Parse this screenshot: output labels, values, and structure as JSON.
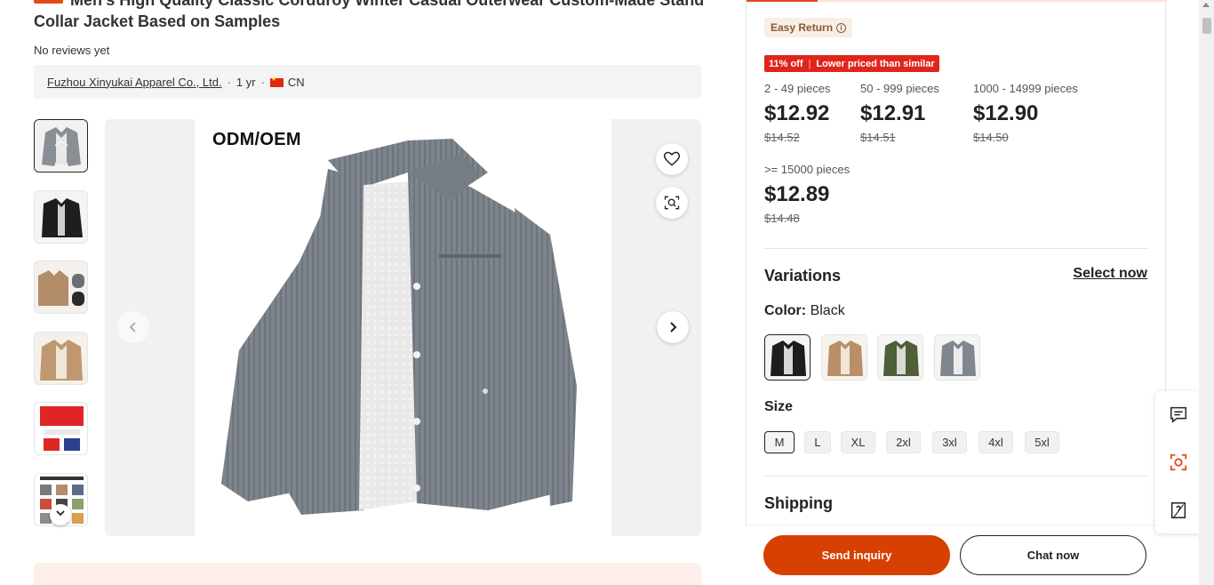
{
  "product": {
    "title": "Men's High Quality Classic Corduroy Winter Casual Outerwear Custom-Made Stand Collar Jacket Based on Samples",
    "reviews": "No reviews yet"
  },
  "supplier": {
    "name": "Fuzhou Xinyukai Apparel Co., Ltd.",
    "years": "1 yr",
    "country": "CN"
  },
  "gallery": {
    "main_label": "ODM/OEM",
    "thumbnails": [
      "gray-jacket-thumbnail",
      "black-jacket-thumbnail",
      "khaki-jacket-set-thumbnail",
      "khaki-jacket-thumbnail",
      "custom-brand-thumbnail",
      "custom-solutions-thumbnail"
    ]
  },
  "panel": {
    "easy_return": "Easy Return",
    "discount_left": "11% off",
    "discount_right": "Lower priced than similar",
    "tiers": [
      {
        "qty": "2 - 49 pieces",
        "price": "$12.92",
        "old": "$14.52"
      },
      {
        "qty": "50 - 999 pieces",
        "price": "$12.91",
        "old": "$14.51"
      },
      {
        "qty": "1000 - 14999 pieces",
        "price": "$12.90",
        "old": "$14.50"
      },
      {
        "qty": ">= 15000 pieces",
        "price": "$12.89",
        "old": "$14.48"
      }
    ],
    "variations_title": "Variations",
    "select_now": "Select now",
    "color_label": "Color:",
    "color_value": "Black",
    "colors": [
      "black",
      "khaki",
      "olive",
      "gray"
    ],
    "size_title": "Size",
    "sizes": [
      "M",
      "L",
      "XL",
      "2xl",
      "3xl",
      "4xl",
      "5xl"
    ],
    "selected_size": "M",
    "shipping_title": "Shipping"
  },
  "cta": {
    "send_inquiry": "Send inquiry",
    "chat_now": "Chat now"
  },
  "floating_tools": [
    "message-icon",
    "ai-scan-icon",
    "feedback-icon"
  ],
  "colors": {
    "accent": "#d64000",
    "discount_red": "#e0261b",
    "easy_return_bg": "#f7efe7"
  }
}
